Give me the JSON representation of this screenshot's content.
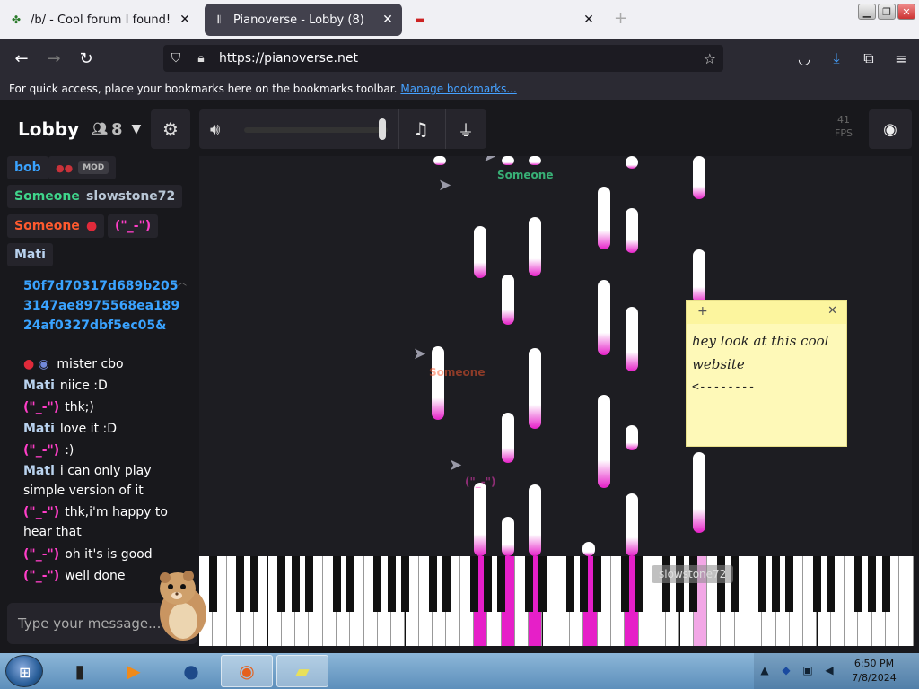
{
  "browser": {
    "tabs": [
      {
        "title": "/b/ - Cool forum I found! - Ran",
        "active": false
      },
      {
        "title": "Pianoverse - Lobby (8)",
        "active": true
      },
      {
        "title": "",
        "active": false
      }
    ],
    "url": "https://pianoverse.net",
    "bookmarks_hint": "For quick access, place your bookmarks here on the bookmarks toolbar.",
    "bookmarks_link": "Manage bookmarks..."
  },
  "header": {
    "lobby_name": "Lobby",
    "user_count": "8",
    "fps_value": "41",
    "fps_label": "FPS"
  },
  "users": [
    {
      "name": "bob",
      "color": "#3aa3ff"
    },
    {
      "name": "MOD",
      "color": "#bbbbbb"
    },
    {
      "name": "Someone",
      "color": "#3fd58b"
    },
    {
      "name": "slowstone72",
      "color": "#b9c7d6"
    },
    {
      "name": "Someone",
      "color": "#ff5a2e"
    },
    {
      "name": "(\"_-\")",
      "color": "#ff3ec8"
    },
    {
      "name": "Mati",
      "color": "#b9d2ee"
    }
  ],
  "chat": [
    {
      "name": "",
      "text": "50f7d70317d689b2053147ae8975568ea18924af0327dbf5ec05&",
      "name_color": "#3aa3ff",
      "text_color": "#3aa3ff"
    },
    {
      "name": "",
      "text": "mister cbo",
      "name_color": "#ffffff",
      "text_color": "#ffffff"
    },
    {
      "name": "Mati",
      "text": "niice :D",
      "name_color": "#b9d2ee",
      "text_color": "#ffffff"
    },
    {
      "name": "(\"_-\")",
      "text": "thk;)",
      "name_color": "#ff3ec8",
      "text_color": "#ffffff"
    },
    {
      "name": "Mati",
      "text": "love it :D",
      "name_color": "#b9d2ee",
      "text_color": "#ffffff"
    },
    {
      "name": "(\"_-\")",
      "text": ":)",
      "name_color": "#ff3ec8",
      "text_color": "#ffffff"
    },
    {
      "name": "Mati",
      "text": "i can only play simple version of it",
      "name_color": "#b9d2ee",
      "text_color": "#ffffff"
    },
    {
      "name": "(\"_-\")",
      "text": "thk,i'm happy to hear that",
      "name_color": "#ff3ec8",
      "text_color": "#ffffff"
    },
    {
      "name": "(\"_-\")",
      "text": "oh it's is good",
      "name_color": "#ff3ec8",
      "text_color": "#ffffff"
    },
    {
      "name": "(\"_-\")",
      "text": "well done",
      "name_color": "#ff3ec8",
      "text_color": "#ffffff"
    }
  ],
  "chat_input": {
    "placeholder": "Type your message..."
  },
  "cursors": [
    {
      "label": "Someone",
      "color": "#3fd58b"
    },
    {
      "label": "Someone",
      "color": "#ff5a2e"
    },
    {
      "label": "(\"_-\")",
      "color": "#ff3ec8"
    },
    {
      "label": "slowstone72",
      "color": "#bbbbbb"
    }
  ],
  "sticky": {
    "line1": "hey look at this cool",
    "line2": "website",
    "line3": "<--------"
  },
  "taskbar": {
    "time": "6:50 PM",
    "date": "7/8/2024"
  },
  "colors": {
    "accent": "#e61fc8",
    "background": "#18181c"
  }
}
